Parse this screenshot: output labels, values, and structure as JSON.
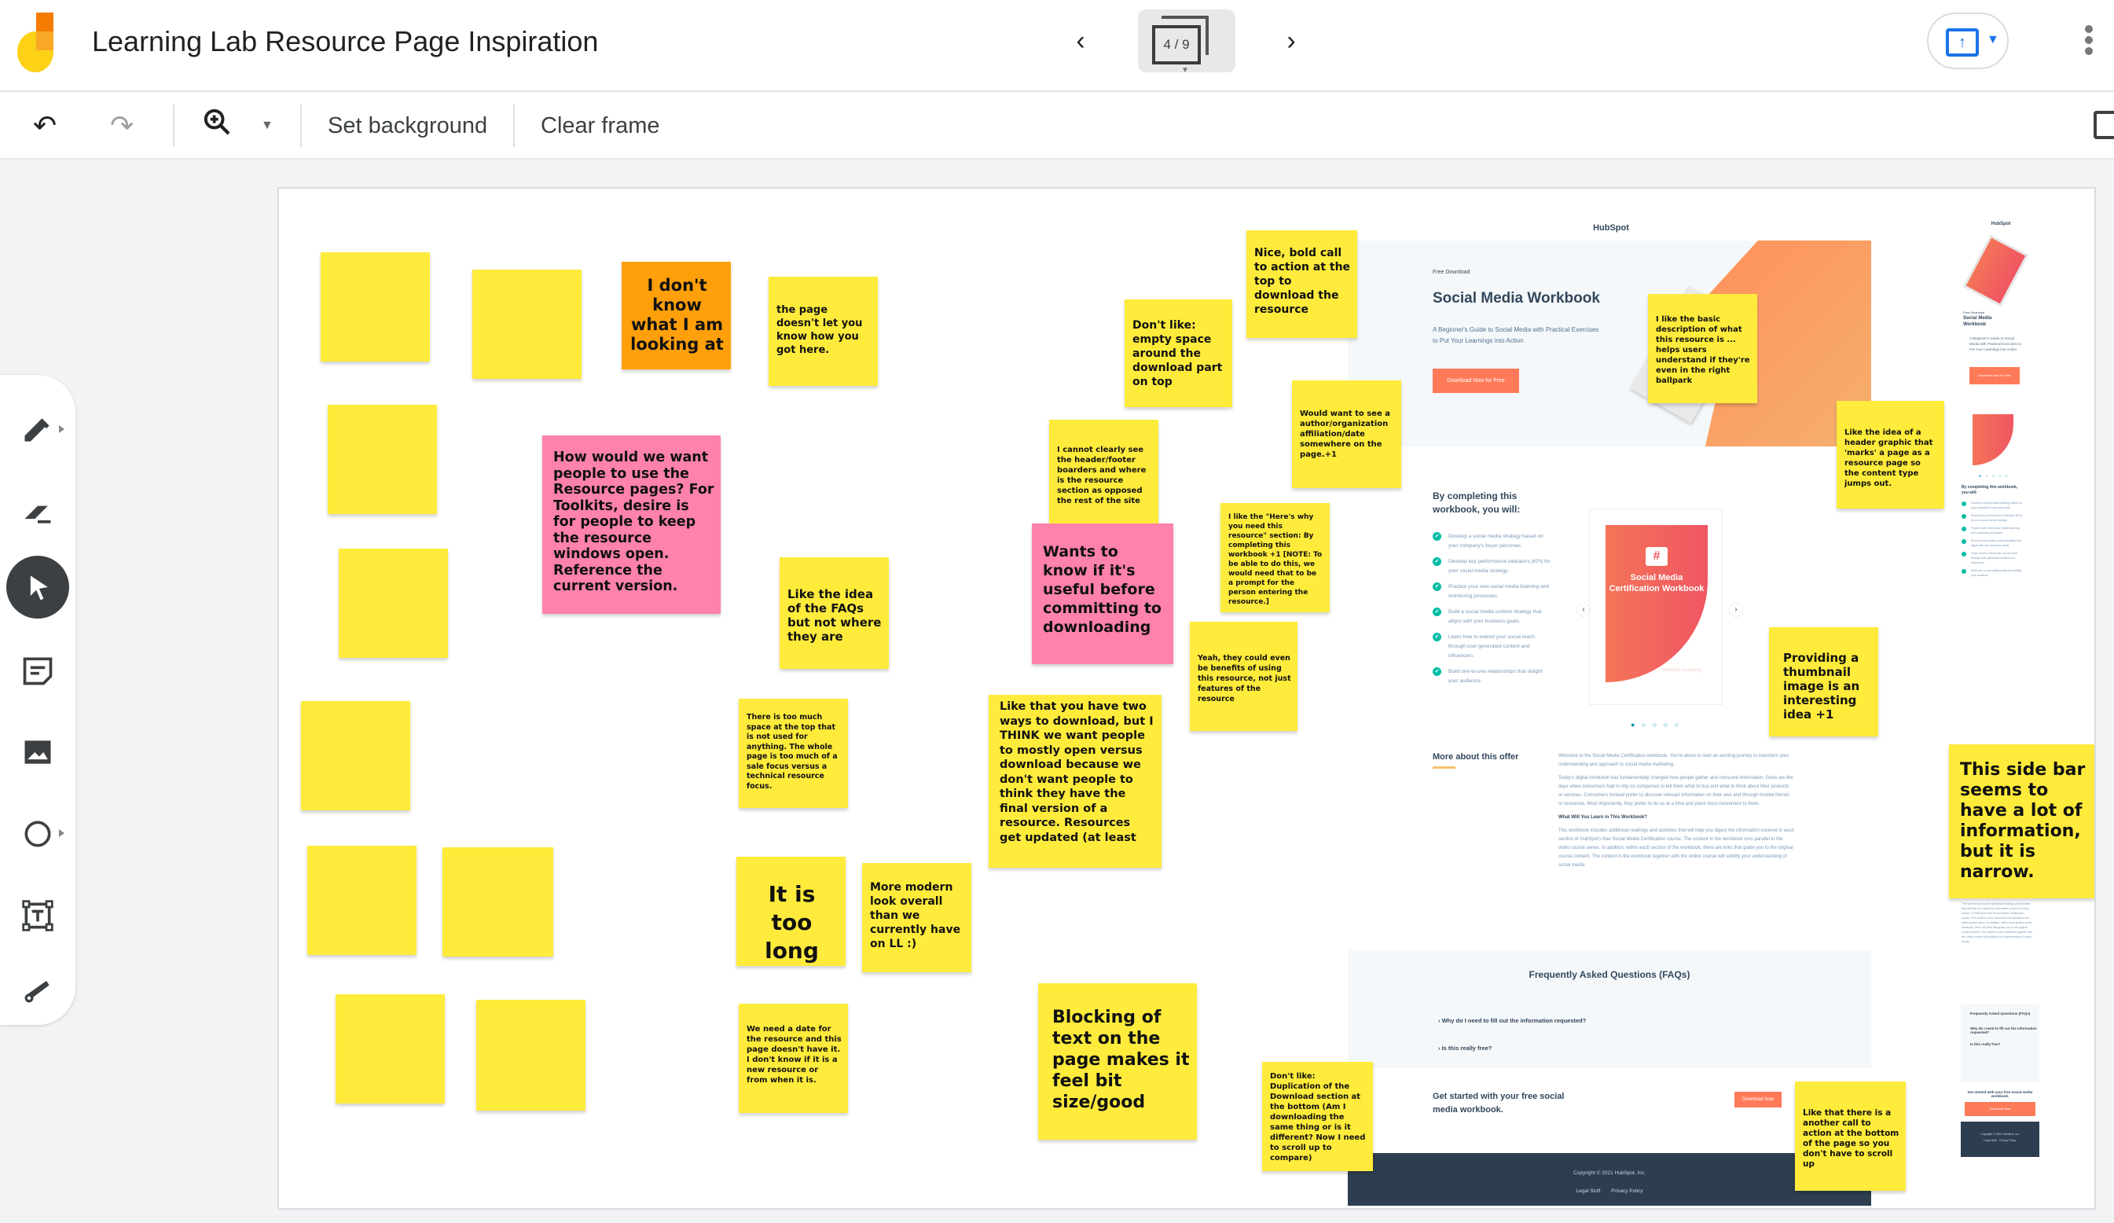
{
  "header": {
    "title": "Learning Lab Resource Page Inspiration",
    "frame_indicator": "4 / 9",
    "prev_icon": "‹",
    "next_icon": "›"
  },
  "toolbar": {
    "undo_icon": "↶",
    "redo_icon": "↷",
    "zoom_icon": "⊕",
    "zoom_caret": "▼",
    "set_background_label": "Set background",
    "clear_frame_label": "Clear frame"
  },
  "tools": [
    {
      "name": "pen",
      "active": false
    },
    {
      "name": "eraser",
      "active": false
    },
    {
      "name": "select",
      "active": true
    },
    {
      "name": "sticky-note",
      "active": false
    },
    {
      "name": "image",
      "active": false
    },
    {
      "name": "circle",
      "active": false
    },
    {
      "name": "text-box",
      "active": false
    },
    {
      "name": "laser",
      "active": false
    }
  ],
  "stickies": [
    {
      "color": "yellow",
      "text": ""
    },
    {
      "color": "yellow",
      "text": ""
    },
    {
      "color": "orange",
      "text": "I don't know what I am looking at"
    },
    {
      "color": "yellow",
      "text": "the page doesn't let you know how you got here."
    },
    {
      "color": "yellow",
      "text": ""
    },
    {
      "color": "pink",
      "text": "How would we want people to use the Resource pages? For Toolkits, desire is for people to keep the resource windows open. Reference the current version."
    },
    {
      "color": "yellow",
      "text": ""
    },
    {
      "color": "yellow",
      "text": "Like the idea of the FAQs but not where they are"
    },
    {
      "color": "yellow",
      "text": ""
    },
    {
      "color": "yellow",
      "text": "There is too much space at the top that is not used for anything. The whole page is too much of a sale focus versus a technical resource focus."
    },
    {
      "color": "yellow",
      "text": ""
    },
    {
      "color": "yellow",
      "text": ""
    },
    {
      "color": "yellow",
      "text": "It is too long"
    },
    {
      "color": "yellow",
      "text": "More modern look overall than we currently have on LL :)"
    },
    {
      "color": "yellow",
      "text": ""
    },
    {
      "color": "yellow",
      "text": ""
    },
    {
      "color": "yellow",
      "text": "We need a date for the resource and this page doesn't have it. I don't know if it is a new resource or from when it is."
    },
    {
      "color": "yellow",
      "text": "Don't like: empty space around the download part on top"
    },
    {
      "color": "yellow",
      "text": "Nice, bold call to action at the top to download the resource"
    },
    {
      "color": "yellow",
      "text": "I cannot clearly see the header/footer boarders and where is the resource section as opposed the rest of the site"
    },
    {
      "color": "pink",
      "text": "Wants to know if it's useful before committing to downloading"
    },
    {
      "color": "yellow",
      "text": "Would want to see a author/organization affiliation/date somewhere on the page.+1"
    },
    {
      "color": "yellow",
      "text": "I like the \"Here's why you need this resource\" section: By completing this workbook +1 [NOTE: To be able to do this, we would need that to be a prompt for the person entering the resource.]"
    },
    {
      "color": "yellow",
      "text": "Yeah, they could even be benefits of using this resource, not just features of the resource"
    },
    {
      "color": "yellow",
      "text": "Like that you have two ways to download, but I THINK we want people to mostly open versus download because we don't want people to think they have the final version of a resource. Resources get updated (at least"
    },
    {
      "color": "yellow",
      "text": "Blocking of text on the page makes it feel bit size/good"
    },
    {
      "color": "yellow",
      "text": "Don't like: Duplication of the Download section at the bottom (Am I downloading the same thing or is it different? Now I need to scroll up to compare)"
    },
    {
      "color": "yellow",
      "text": "I like the basic description of what this resource is ... helps users understand if they're even in the right ballpark"
    },
    {
      "color": "yellow",
      "text": "Like the idea of a header graphic that 'marks' a page as a resource page so the content type jumps out."
    },
    {
      "color": "yellow",
      "text": "Providing a thumbnail image is an interesting idea +1"
    },
    {
      "color": "yellow",
      "text": "This side bar seems to have a lot of information, but it is narrow."
    },
    {
      "color": "yellow",
      "text": "Like that there is a another call to action at the bottom of the page so you don't have to scroll up"
    }
  ],
  "hubspot_page": {
    "logo": "HubSpot",
    "kicker": "Free Download",
    "title": "Social Media Workbook",
    "description": "A Beginner's Guide to Social Media with Practical Exercises to Put Your Learnings into Action",
    "cta": "Download Now for Free",
    "complete_title": "By completing this workbook, you will:",
    "benefits": [
      "Develop a social media strategy based on your company's buyer personas.",
      "Develop key performance indicators (KPI) for your social media strategy.",
      "Practice your new social media listening and monitoring processes.",
      "Build a social media content strategy that aligns with your business goals.",
      "Learn how to extend your social reach through user generated content and influencers.",
      "Build one-to-one relationships that delight your audience."
    ],
    "cover_title": "Social Media Certification Workbook",
    "cover_brand": "HubSpot Academy",
    "carousel_dots": "● ○ ○ ○ ○",
    "carousel_prev": "‹",
    "carousel_next": "›",
    "more_title": "More about this offer",
    "more_paragraphs": [
      "Welcome to the Social Media Certification workbook. You're about to start an exciting journey to transform your understanding and approach to social media marketing.",
      "Today's digital revolution has fundamentally changed how people gather and consume information. Gone are the days when consumers had to rely on companies to tell them what to buy and what to think about their products or services. Consumers instead prefer to discover relevant information on their own and through trusted friends or resources. Most importantly, they prefer to do so at a time and place most convenient to them."
    ],
    "more_subheading": "What Will You Learn in This Workbook?",
    "more_paragraph_2": "This workbook includes additional readings and activities that will help you digest the information covered in each section of HubSpot's free Social Media Certification course. The content in the workbook runs parallel to the video course series. In addition, within each section of the workbook, there are links that guide you to the original course content. The content in the workbook together with the online course will solidify your understanding of social media.",
    "faq_title": "Frequently Asked Questions (FAQs)",
    "faqs": [
      "Why do I need to fill out the information requested?",
      "Is this really free?"
    ],
    "bottom_cta_text": "Get started with your free social media workbook.",
    "bottom_cta_button": "Download Now",
    "copyright": "Copyright © 2021 HubSpot, Inc.",
    "footer_links": [
      "Legal Stuff",
      "Privacy Policy"
    ]
  },
  "colors": {
    "sticky_yellow": "#ffeb3b",
    "sticky_orange": "#ff9f0a",
    "sticky_pink": "#ff82aa",
    "hubspot_orange": "#ff7a59",
    "accent_blue": "#1a73e8"
  }
}
